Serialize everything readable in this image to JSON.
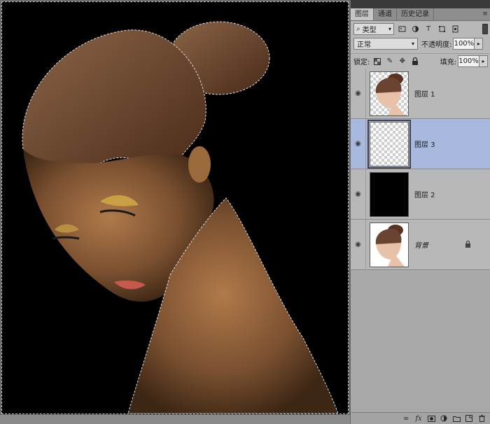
{
  "panel": {
    "tabs": [
      {
        "label": "图层"
      },
      {
        "label": "通道"
      },
      {
        "label": "历史记录"
      }
    ],
    "menu_icon": "≡"
  },
  "filter": {
    "kind_label": "类型",
    "search_icon": "search-icon",
    "icons": [
      "image-filter-icon",
      "adjustment-filter-icon",
      "type-filter-icon",
      "shape-filter-icon",
      "smart-object-filter-icon"
    ]
  },
  "blend": {
    "mode": "正常",
    "opacity_label": "不透明度:",
    "opacity_value": "100%"
  },
  "lock": {
    "label": "锁定:",
    "fill_label": "填充:",
    "fill_value": "100%"
  },
  "layers": [
    {
      "name": "图层 1",
      "visible": true,
      "selected": false,
      "thumb": "portrait-transparent"
    },
    {
      "name": "图层 3",
      "visible": true,
      "selected": true,
      "thumb": "transparent"
    },
    {
      "name": "图层 2",
      "visible": true,
      "selected": false,
      "thumb": "black"
    },
    {
      "name": "背景",
      "visible": true,
      "selected": false,
      "thumb": "portrait-white",
      "locked": true
    }
  ],
  "bottom_icons": [
    "link-icon",
    "fx-icon",
    "mask-icon",
    "adjustment-icon",
    "group-icon",
    "new-layer-icon",
    "trash-icon"
  ],
  "colors": {
    "selected_layer": "#a8b8de",
    "panel_bg": "#b8b8b8",
    "canvas_bg": "#000000"
  }
}
